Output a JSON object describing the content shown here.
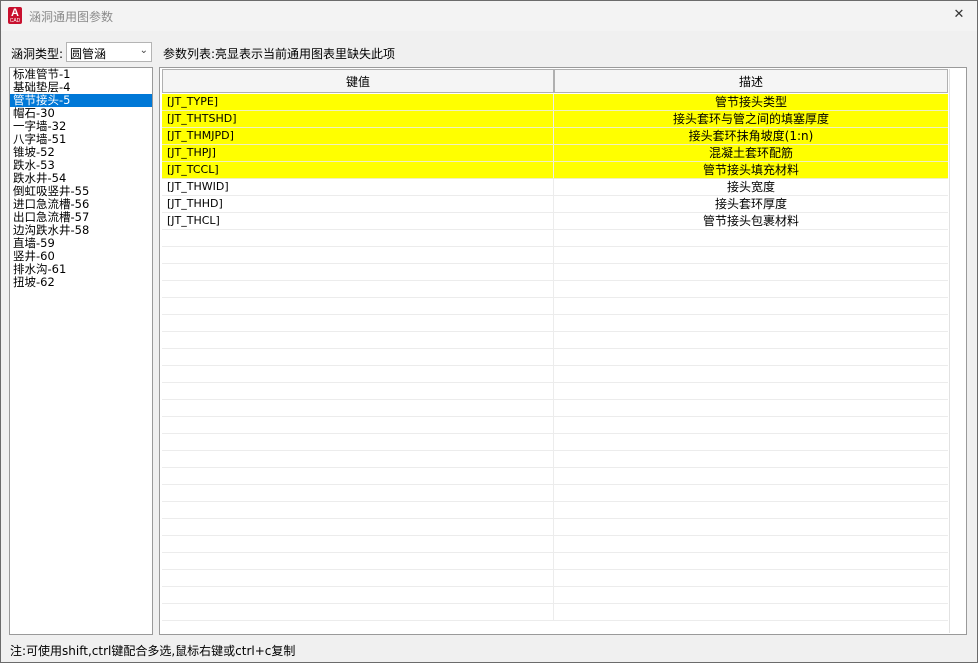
{
  "window": {
    "title": "涵洞通用图参数",
    "app_icon_label": "A",
    "app_icon_sub": "CAD",
    "close_glyph": "✕"
  },
  "toolbar": {
    "type_label": "涵洞类型:",
    "type_value": "圆管涵",
    "hint": "参数列表:亮显表示当前通用图表里缺失此项"
  },
  "list": {
    "items": [
      "标准管节-1",
      "基础垫层-4",
      "管节接头-5",
      "帽石-30",
      "一字墙-32",
      "八字墙-51",
      "锥坡-52",
      "跌水-53",
      "跌水井-54",
      "倒虹吸竖井-55",
      "进口急流槽-56",
      "出口急流槽-57",
      "边沟跌水井-58",
      "直墙-59",
      "竖井-60",
      "排水沟-61",
      "扭坡-62"
    ],
    "selected_index": 2
  },
  "table": {
    "headers": [
      "键值",
      "描述"
    ],
    "rows": [
      {
        "key": "[JT_TYPE]",
        "desc": "管节接头类型",
        "highlight": true
      },
      {
        "key": "[JT_THTSHD]",
        "desc": "接头套环与管之间的填塞厚度",
        "highlight": true
      },
      {
        "key": "[JT_THMJPD]",
        "desc": "接头套环抹角坡度(1:n)",
        "highlight": true
      },
      {
        "key": "[JT_THPJ]",
        "desc": "混凝土套环配筋",
        "highlight": true
      },
      {
        "key": "[JT_TCCL]",
        "desc": "管节接头填充材料",
        "highlight": true
      },
      {
        "key": "[JT_THWID]",
        "desc": "接头宽度",
        "highlight": false
      },
      {
        "key": "[JT_THHD]",
        "desc": "接头套环厚度",
        "highlight": false
      },
      {
        "key": "[JT_THCL]",
        "desc": "管节接头包裹材料",
        "highlight": false
      }
    ],
    "highlight_color": "#ffff00"
  },
  "footer": {
    "note": "注:可使用shift,ctrl键配合多选,鼠标右键或ctrl+c复制"
  },
  "colors": {
    "selection": "#0078d7",
    "highlight": "#ffff00",
    "app_icon": "#c8102e"
  }
}
